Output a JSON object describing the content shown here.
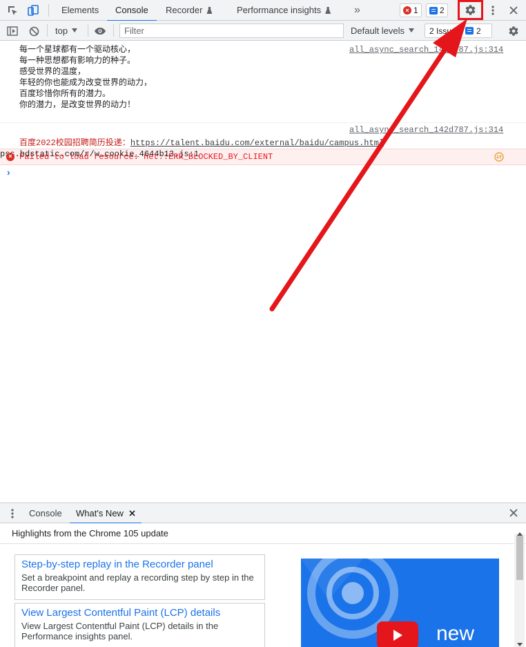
{
  "tabs": {
    "items": [
      {
        "label": "Elements"
      },
      {
        "label": "Console"
      },
      {
        "label": "Recorder"
      },
      {
        "label": "Performance insights"
      }
    ],
    "more": "»",
    "errors_count": "1",
    "messages_count": "2"
  },
  "toolbar": {
    "context": "top",
    "filter_placeholder": "Filter",
    "levels": "Default levels",
    "issues_label": "2 Issues:",
    "issues_count": "2"
  },
  "console": {
    "messages": [
      {
        "source": "all_async_search_142d787.js:314",
        "lines": [
          "每一个星球都有一个驱动核心，",
          "每一种思想都有影响力的种子。",
          "感受世界的温度，",
          "年轻的你也能成为改变世界的动力，",
          "百度珍惜你所有的潜力。",
          "你的潜力，是改变世界的动力！"
        ]
      },
      {
        "source": "all_async_search_142d787.js:314",
        "prefix": "百度2022校园招聘简历投递：",
        "link": "https://talent.baidu.com/external/baidu/campus.html"
      }
    ],
    "error": {
      "text": "Failed to load resource: net::ERR_BLOCKED_BY_CLIENT",
      "source": "pss.bdstatic.com/r/w…cookie_4644b13.js:1"
    },
    "prompt": "›"
  },
  "drawer": {
    "tabs": [
      {
        "label": "Console"
      },
      {
        "label": "What's New"
      }
    ],
    "heading": "Highlights from the Chrome 105 update",
    "cards": [
      {
        "title": "Step-by-step replay in the Recorder panel",
        "desc": "Set a breakpoint and replay a recording step by step in the Recorder panel."
      },
      {
        "title": "View Largest Contentful Paint (LCP) details",
        "desc": "View Largest Contentful Paint (LCP) details in the Performance insights panel."
      }
    ],
    "video_text": "new"
  },
  "colors": {
    "accent": "#1a73e8",
    "error": "#e4161b",
    "annotation": "#e4161b"
  }
}
